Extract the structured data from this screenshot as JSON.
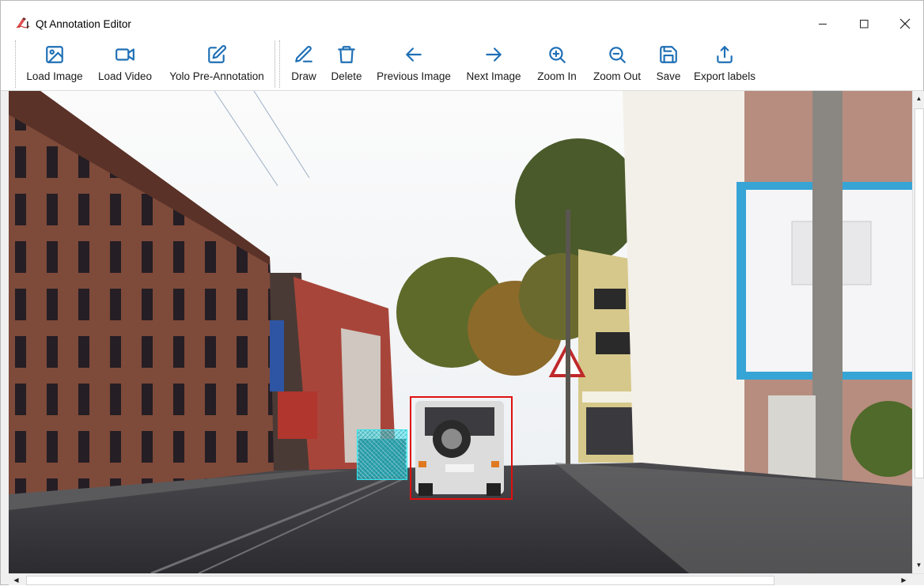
{
  "window": {
    "title": "Qt Annotation Editor",
    "controls": {
      "minimize": "minimize",
      "maximize": "maximize",
      "close": "close"
    }
  },
  "toolbar": {
    "items": [
      {
        "label": "Load Image",
        "icon": "image-icon"
      },
      {
        "label": "Load Video",
        "icon": "video-icon"
      },
      {
        "label": "Yolo Pre-Annotation",
        "icon": "edit-icon"
      },
      {
        "label": "Draw",
        "icon": "pen-icon"
      },
      {
        "label": "Delete",
        "icon": "trash-icon"
      },
      {
        "label": "Previous Image",
        "icon": "arrow-left-icon"
      },
      {
        "label": "Next Image",
        "icon": "arrow-right-icon"
      },
      {
        "label": "Zoom In",
        "icon": "zoom-in-icon"
      },
      {
        "label": "Zoom Out",
        "icon": "zoom-out-icon"
      },
      {
        "label": "Save",
        "icon": "save-icon"
      },
      {
        "label": "Export labels",
        "icon": "export-icon"
      }
    ]
  },
  "canvas": {
    "annotations": [
      {
        "label": "car",
        "style": "outline",
        "color": "#e01010"
      },
      {
        "label": "car",
        "style": "hatched-fill",
        "color": "#2fe6f0"
      }
    ]
  },
  "colors": {
    "accent": "#1e6fb5",
    "bbox_selected": "#e01010",
    "bbox_fill": "#2fe6f0"
  }
}
